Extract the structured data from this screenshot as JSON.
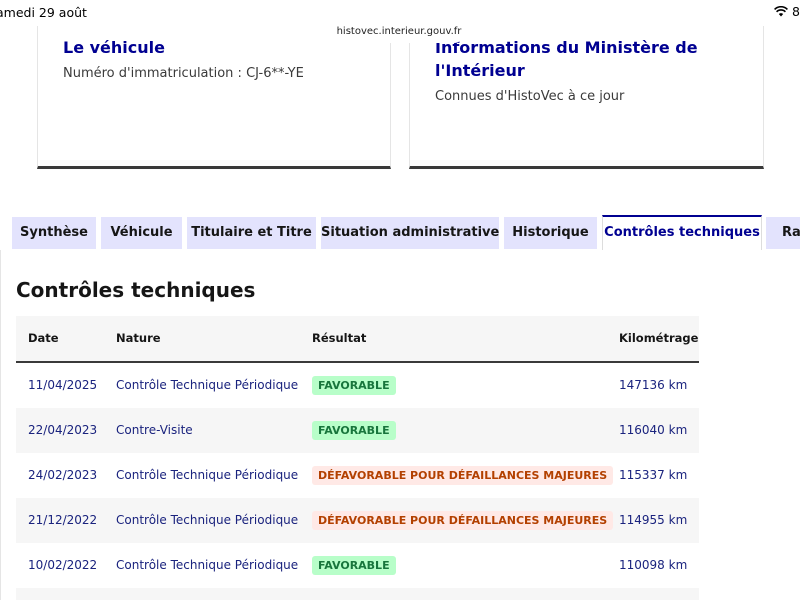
{
  "status": {
    "date": "amedi 29 août",
    "battery": "8"
  },
  "browser": {
    "url": "histovec.interieur.gouv.fr"
  },
  "cards": {
    "vehicle": {
      "title": "Le véhicule",
      "text": "Numéro d'immatriculation : CJ-6**-YE"
    },
    "ministry": {
      "title": "Informations du Ministère de l'Intérieur",
      "text": "Connues d'HistoVec à ce jour"
    }
  },
  "tabs": [
    {
      "label": "Synthèse"
    },
    {
      "label": "Véhicule"
    },
    {
      "label": "Titulaire et Titre"
    },
    {
      "label": "Situation administrative"
    },
    {
      "label": "Historique"
    },
    {
      "label": "Contrôles techniques"
    },
    {
      "label": "Rap"
    }
  ],
  "active_tab": "Contrôles techniques",
  "section": {
    "title": "Contrôles techniques"
  },
  "table": {
    "headers": {
      "date": "Date",
      "nature": "Nature",
      "result": "Résultat",
      "km": "Kilométrage"
    },
    "rows": [
      {
        "date": "11/04/2025",
        "nature": "Contrôle Technique Périodique",
        "result": "FAVORABLE",
        "status": "ok",
        "km": "147136 km"
      },
      {
        "date": "22/04/2023",
        "nature": "Contre-Visite",
        "result": "FAVORABLE",
        "status": "ok",
        "km": "116040 km"
      },
      {
        "date": "24/02/2023",
        "nature": "Contrôle Technique Périodique",
        "result": "DÉFAVORABLE POUR DÉFAILLANCES MAJEURES",
        "status": "ko",
        "km": "115337 km"
      },
      {
        "date": "21/12/2022",
        "nature": "Contrôle Technique Périodique",
        "result": "DÉFAVORABLE POUR DÉFAILLANCES MAJEURES",
        "status": "ko",
        "km": "114955 km"
      },
      {
        "date": "10/02/2022",
        "nature": "Contrôle Technique Périodique",
        "result": "FAVORABLE",
        "status": "ok",
        "km": "110098 km"
      }
    ]
  },
  "colors": {
    "primary": "#000091",
    "tab_bg": "#e3e3fd",
    "ok_bg": "#b8fec9",
    "ok_fg": "#18753c",
    "ko_bg": "#ffe9e6",
    "ko_fg": "#b34000"
  }
}
